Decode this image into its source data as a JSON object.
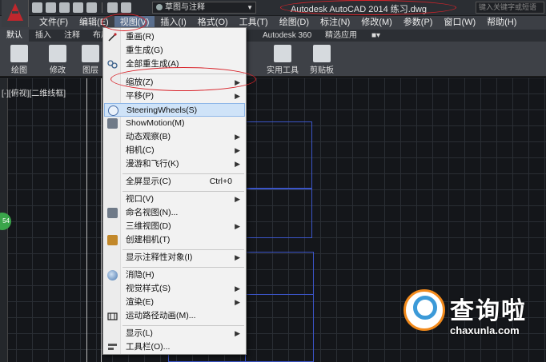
{
  "window": {
    "title": "Autodesk AutoCAD 2014    练习.dwg",
    "workspace": "草图与注释",
    "search_placeholder": "键入关键字或短语",
    "annotation_color": "#d8232a"
  },
  "menubar": {
    "items": [
      "文件(F)",
      "编辑(E)",
      "视图(V)",
      "插入(I)",
      "格式(O)",
      "工具(T)",
      "绘图(D)",
      "标注(N)",
      "修改(M)",
      "参数(P)",
      "窗口(W)",
      "帮助(H)"
    ],
    "active": "视图(V)"
  },
  "ribbon": {
    "tabs": [
      "默认",
      "插入",
      "注释",
      "布局"
    ],
    "tabs_right": [
      "Autodesk 360",
      "精选应用"
    ],
    "buttons": [
      "绘图",
      "修改",
      "图层",
      "实用工具",
      "剪贴板"
    ]
  },
  "viewport": {
    "label": "[-][俯视][二维线框]",
    "badge": "54"
  },
  "view_menu": {
    "items": [
      {
        "label": "重画(R)",
        "icon": "redraw-icon"
      },
      {
        "label": "重生成(G)",
        "icon": ""
      },
      {
        "label": "全部重生成(A)",
        "icon": "regen-all-icon"
      },
      {
        "label": "缩放(Z)",
        "icon": "",
        "submenu": true
      },
      {
        "label": "平移(P)",
        "icon": "",
        "submenu": true
      },
      {
        "label": "SteeringWheels(S)",
        "icon": "steeringwheels-icon",
        "highlighted": true
      },
      {
        "label": "ShowMotion(M)",
        "icon": "showmotion-icon"
      },
      {
        "label": "动态观察(B)",
        "icon": "",
        "submenu": true
      },
      {
        "label": "相机(C)",
        "icon": "",
        "submenu": true
      },
      {
        "label": "漫游和飞行(K)",
        "icon": "",
        "submenu": true
      },
      {
        "label": "全屏显示(C)",
        "icon": "",
        "shortcut": "Ctrl+0"
      },
      {
        "label": "视口(V)",
        "icon": "",
        "submenu": true
      },
      {
        "label": "命名视图(N)...",
        "icon": "named-view-icon"
      },
      {
        "label": "三维视图(D)",
        "icon": "",
        "submenu": true
      },
      {
        "label": "创建相机(T)",
        "icon": "camera-icon"
      },
      {
        "label": "显示注释性对象(I)",
        "icon": "",
        "submenu": true
      },
      {
        "label": "消隐(H)",
        "icon": "hide-icon"
      },
      {
        "label": "视觉样式(S)",
        "icon": "",
        "submenu": true
      },
      {
        "label": "渲染(E)",
        "icon": "",
        "submenu": true
      },
      {
        "label": "运动路径动画(M)...",
        "icon": "motion-path-icon"
      },
      {
        "label": "显示(L)",
        "icon": "",
        "submenu": true
      },
      {
        "label": "工具栏(O)...",
        "icon": "toolbar-icon"
      }
    ]
  },
  "watermark": {
    "brand": "查询啦",
    "domain": "chaxunla.com"
  }
}
